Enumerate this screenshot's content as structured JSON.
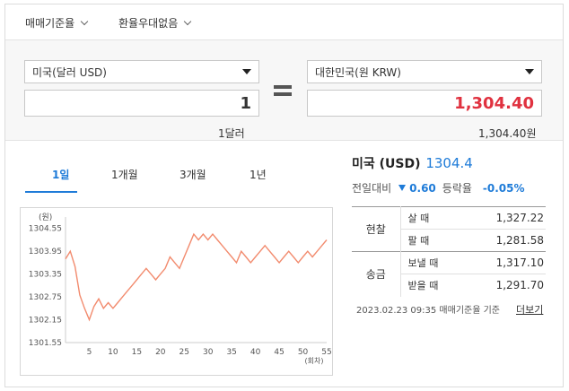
{
  "topbar": {
    "rate_type": "매매기준율",
    "preferential": "환율우대없음"
  },
  "converter": {
    "from_currency": "미국(달러 USD)",
    "to_currency": "대한민국(원 KRW)",
    "from_amount": "1",
    "to_amount": "1,304.40",
    "from_text": "1달러",
    "to_text": "1,304.40원"
  },
  "tabs": [
    {
      "label": "1일",
      "active": true
    },
    {
      "label": "1개월",
      "active": false
    },
    {
      "label": "3개월",
      "active": false
    },
    {
      "label": "1년",
      "active": false
    }
  ],
  "info": {
    "country": "미국 (USD)",
    "rate": "1304.4",
    "diff_label": "전일대비",
    "diff_value": "0.60",
    "change_label": "등락율",
    "change_value": "-0.05%"
  },
  "rates_table": {
    "cash_label": "현찰",
    "transfer_label": "송금",
    "rows": [
      {
        "label": "살 때",
        "value": "1,327.22"
      },
      {
        "label": "팔 때",
        "value": "1,281.58"
      },
      {
        "label": "보낼 때",
        "value": "1,317.10"
      },
      {
        "label": "받을 때",
        "value": "1,291.70"
      }
    ]
  },
  "footnote": "2023.02.23 09:35 매매기준율 기준",
  "more_link": "더보기",
  "colors": {
    "accent": "#1e7bd8",
    "krw_amount": "#e0313f",
    "line": "#f28b6e"
  },
  "chart_data": {
    "type": "line",
    "ylabel": "(원)",
    "xlabel": "(회차)",
    "yticks": [
      "1304.55",
      "1303.95",
      "1303.35",
      "1302.75",
      "1302.15",
      "1301.55"
    ],
    "ytick_values": [
      1304.55,
      1303.95,
      1303.35,
      1302.75,
      1302.15,
      1301.55
    ],
    "xticks": [
      "5",
      "10",
      "15",
      "20",
      "25",
      "30",
      "35",
      "40",
      "45",
      "50",
      "55"
    ],
    "xtick_values": [
      5,
      10,
      15,
      20,
      25,
      30,
      35,
      40,
      45,
      50,
      55
    ],
    "ylim": [
      1301.55,
      1304.85
    ],
    "xlim": [
      0,
      55
    ],
    "grid": false,
    "series": [
      {
        "x": [
          0,
          1,
          2,
          3,
          4,
          5,
          6,
          7,
          8,
          9,
          10,
          11,
          12,
          13,
          14,
          15,
          16,
          17,
          18,
          19,
          20,
          21,
          22,
          23,
          24,
          25,
          26,
          27,
          28,
          29,
          30,
          31,
          32,
          33,
          34,
          35,
          36,
          37,
          38,
          39,
          40,
          41,
          42,
          43,
          44,
          45,
          46,
          47,
          48,
          49,
          50,
          51,
          52,
          53,
          54,
          55
        ],
        "values": [
          1303.75,
          1303.95,
          1303.55,
          1302.8,
          1302.45,
          1302.15,
          1302.5,
          1302.7,
          1302.45,
          1302.6,
          1302.45,
          1302.6,
          1302.75,
          1302.9,
          1303.05,
          1303.2,
          1303.35,
          1303.5,
          1303.35,
          1303.2,
          1303.35,
          1303.5,
          1303.8,
          1303.65,
          1303.5,
          1303.8,
          1304.1,
          1304.4,
          1304.25,
          1304.4,
          1304.25,
          1304.4,
          1304.25,
          1304.1,
          1303.95,
          1303.8,
          1303.65,
          1303.95,
          1303.8,
          1303.65,
          1303.8,
          1303.95,
          1304.1,
          1303.95,
          1303.8,
          1303.65,
          1303.8,
          1303.95,
          1303.8,
          1303.65,
          1303.8,
          1303.95,
          1303.8,
          1303.95,
          1304.1,
          1304.25
        ]
      }
    ]
  }
}
